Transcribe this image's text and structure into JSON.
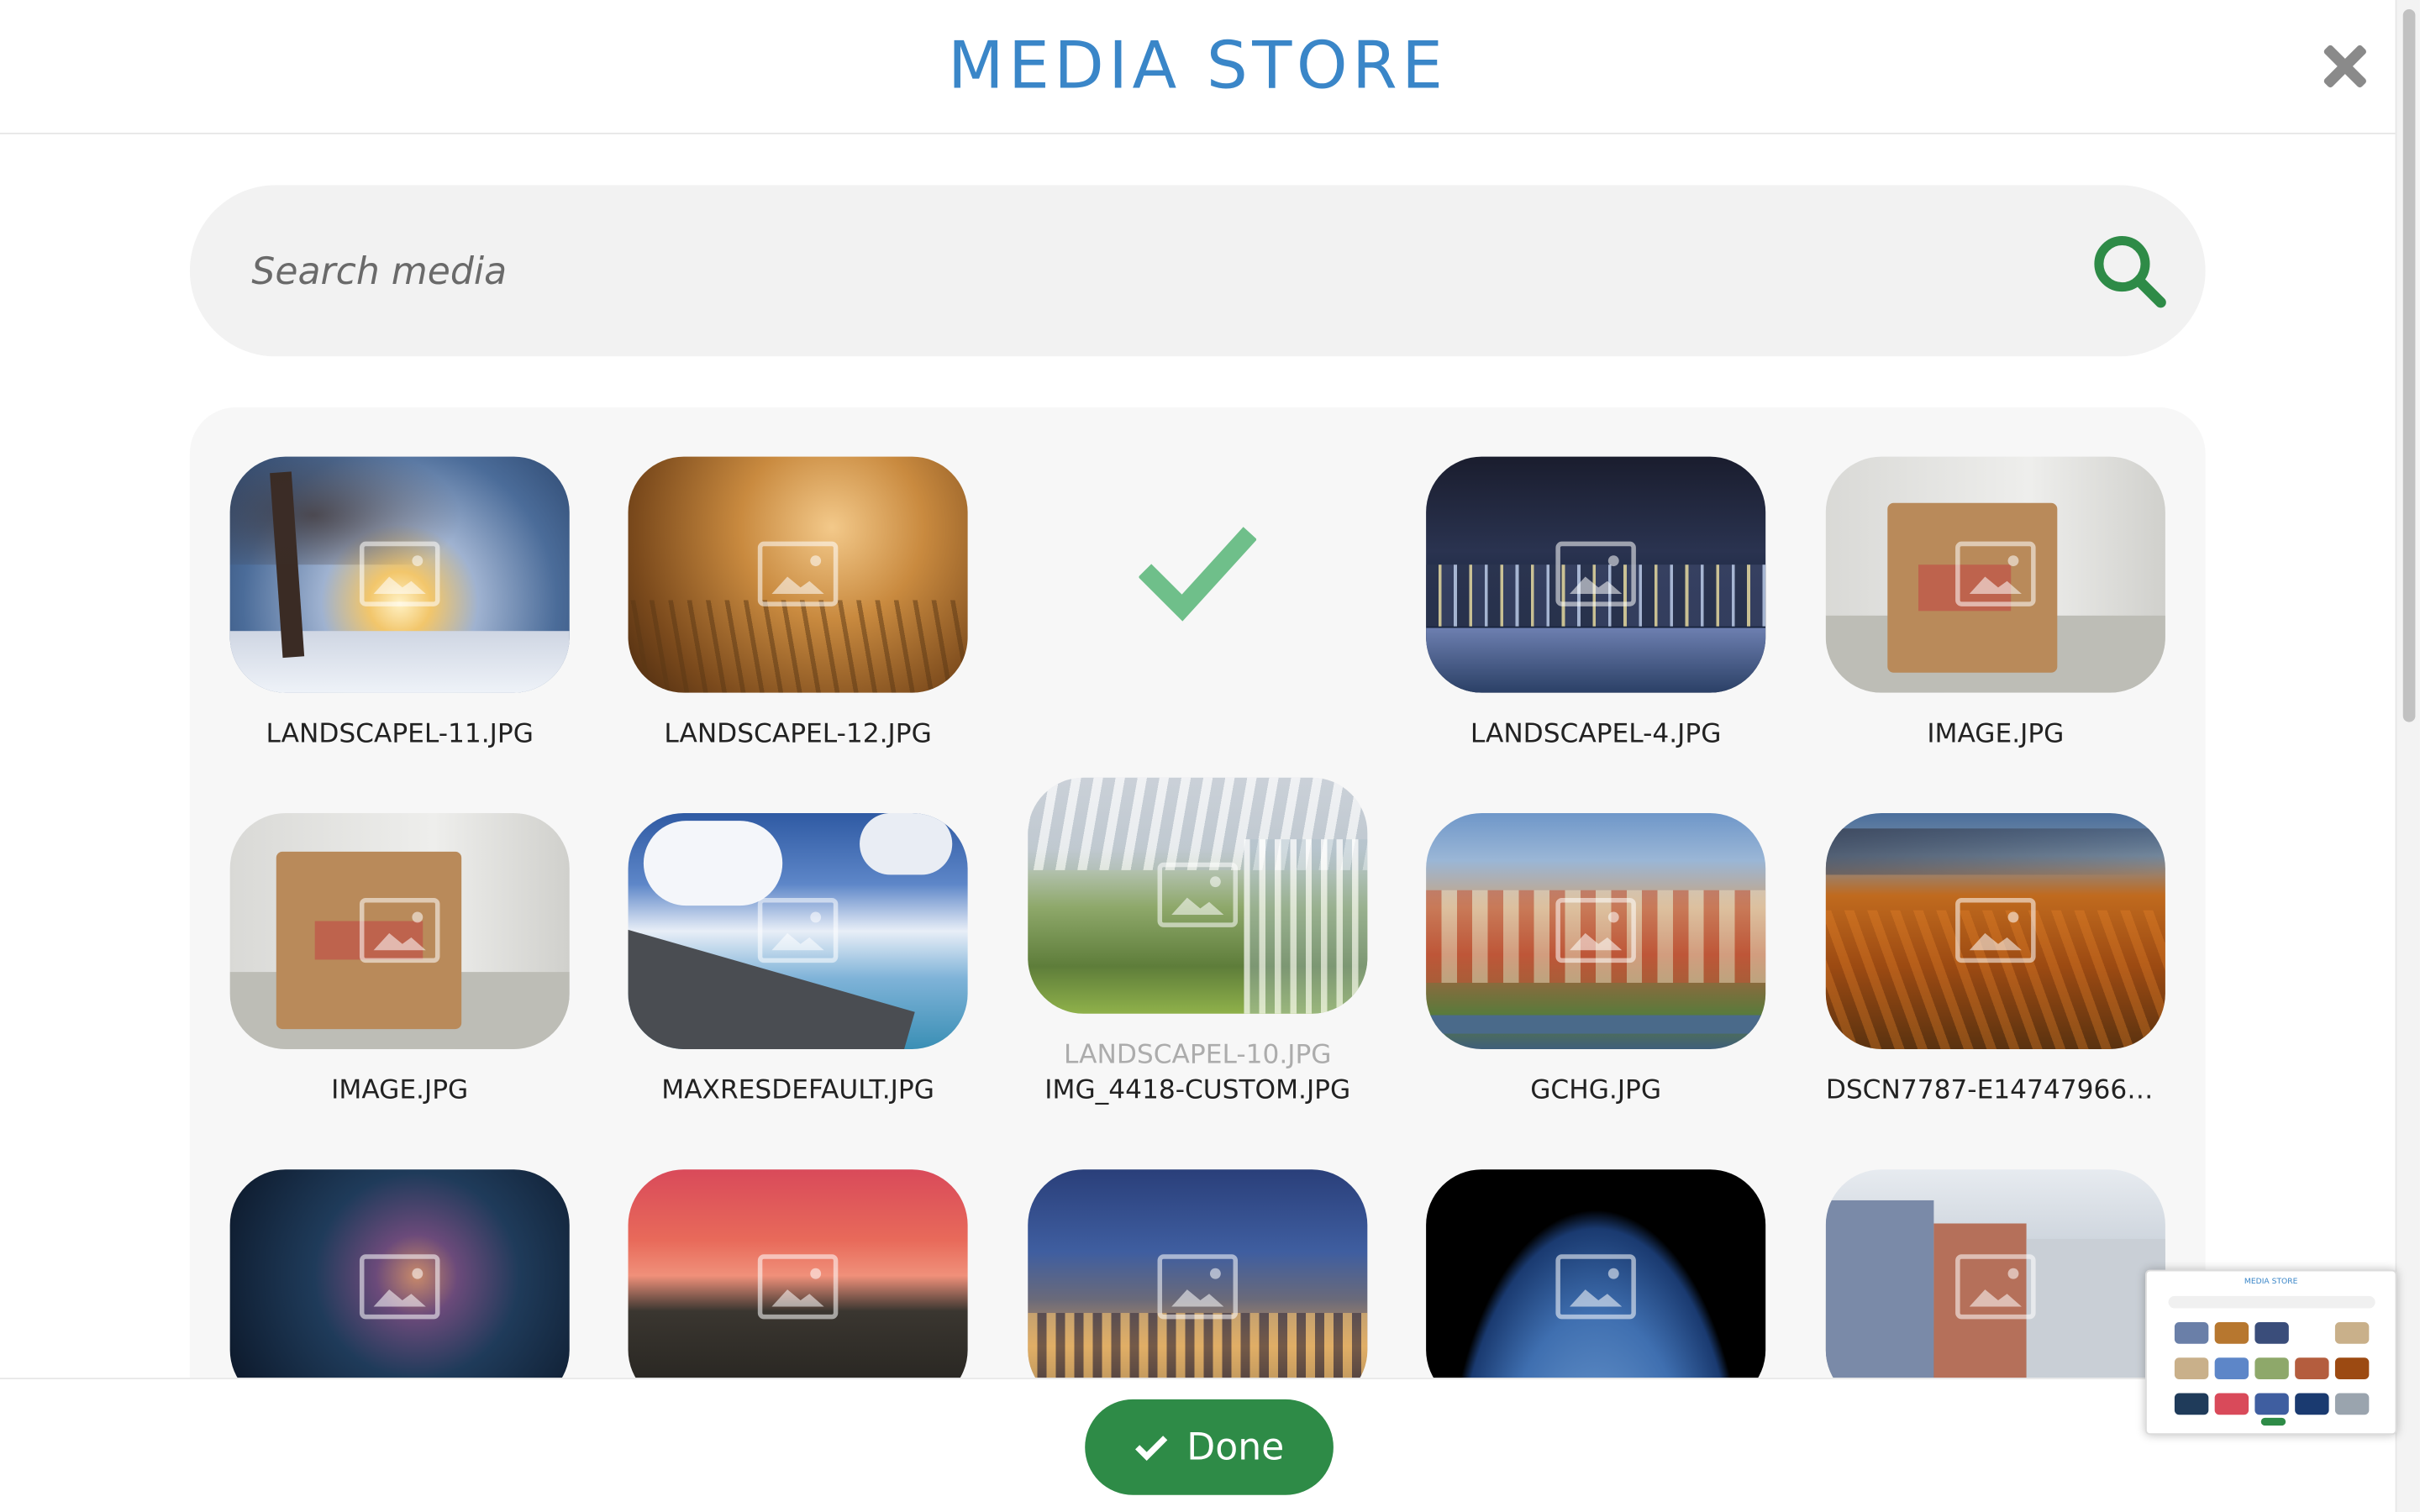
{
  "header": {
    "title": "MEDIA STORE",
    "close_icon": "close-icon"
  },
  "search": {
    "placeholder": "Search media",
    "value": "",
    "icon": "search-icon",
    "icon_color": "#2e8b47"
  },
  "media": [
    {
      "name": "LANDSCAPEL-11.JPG",
      "selected": false
    },
    {
      "name": "LANDSCAPEL-12.JPG",
      "selected": false
    },
    {
      "name": "",
      "selected": true
    },
    {
      "name": "LANDSCAPEL-4.JPG",
      "selected": false
    },
    {
      "name": "IMAGE.JPG",
      "selected": false
    },
    {
      "name": "IMAGE.JPG",
      "selected": false
    },
    {
      "name": "MAXRESDEFAULT.JPG",
      "selected": false
    },
    {
      "name": "IMG_4418-CUSTOM.JPG",
      "selected": false,
      "drag_ghost": "LANDSCAPEL-10.JPG"
    },
    {
      "name": "GCHG.JPG",
      "selected": false
    },
    {
      "name": "DSCN7787-E14747966606...",
      "selected": false
    },
    {
      "name": "",
      "selected": false
    },
    {
      "name": "",
      "selected": false
    },
    {
      "name": "",
      "selected": false
    },
    {
      "name": "",
      "selected": false
    },
    {
      "name": "",
      "selected": false
    }
  ],
  "footer": {
    "done_label": "Done",
    "done_icon": "check-icon",
    "accent": "#2e8b47"
  },
  "minimap": {
    "title": "MEDIA STORE"
  },
  "colors": {
    "title": "#3a86c8",
    "accent": "#2e8b47",
    "check": "#6fbf8a"
  }
}
